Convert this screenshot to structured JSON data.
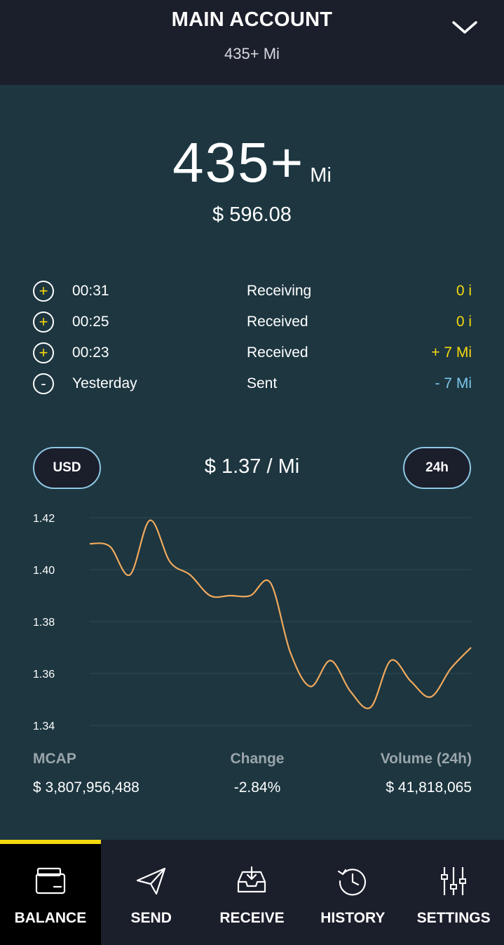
{
  "header": {
    "title": "MAIN ACCOUNT",
    "subtitle": "435+ Mi"
  },
  "balance": {
    "amount": "435+",
    "unit": "Mi",
    "usd": "$ 596.08"
  },
  "transactions": [
    {
      "sign": "+",
      "time": "00:31",
      "type": "Receiving",
      "amount": "0 i",
      "direction": "in"
    },
    {
      "sign": "+",
      "time": "00:25",
      "type": "Received",
      "amount": "0 i",
      "direction": "in"
    },
    {
      "sign": "+",
      "time": "00:23",
      "type": "Received",
      "amount": "+ 7 Mi",
      "direction": "in"
    },
    {
      "sign": "-",
      "time": "Yesterday",
      "type": "Sent",
      "amount": "- 7 Mi",
      "direction": "out"
    }
  ],
  "price": {
    "currency_button": "USD",
    "rate": "$ 1.37 / Mi",
    "range_button": "24h"
  },
  "chart_data": {
    "type": "line",
    "yticks": [
      "1.42",
      "1.40",
      "1.38",
      "1.36",
      "1.34"
    ],
    "ylim": [
      1.34,
      1.42
    ],
    "x": [
      0,
      1,
      2,
      3,
      4,
      5,
      6,
      7,
      8,
      9,
      10,
      11,
      12,
      13,
      14,
      15,
      16,
      17,
      18,
      19
    ],
    "values": [
      1.41,
      1.409,
      1.398,
      1.419,
      1.403,
      1.398,
      1.39,
      1.39,
      1.39,
      1.395,
      1.368,
      1.355,
      1.365,
      1.353,
      1.347,
      1.365,
      1.357,
      1.351,
      1.362,
      1.37
    ],
    "grid": true,
    "line_color": "#f0a95c"
  },
  "stats": {
    "mcap_label": "MCAP",
    "mcap_value": "$ 3,807,956,488",
    "change_label": "Change",
    "change_value": "-2.84%",
    "volume_label": "Volume (24h)",
    "volume_value": "$ 41,818,065"
  },
  "nav": [
    {
      "label": "BALANCE",
      "icon": "wallet-icon",
      "active": true
    },
    {
      "label": "SEND",
      "icon": "paper-plane-icon",
      "active": false
    },
    {
      "label": "RECEIVE",
      "icon": "inbox-download-icon",
      "active": false
    },
    {
      "label": "HISTORY",
      "icon": "history-clock-icon",
      "active": false
    },
    {
      "label": "SETTINGS",
      "icon": "sliders-icon",
      "active": false
    }
  ],
  "colors": {
    "background": "#1d3640",
    "header": "#1b1e2b",
    "accent_yellow": "#f5d90f",
    "outgoing_blue": "#7cc6ec",
    "pill_border": "#8fc7e3"
  }
}
